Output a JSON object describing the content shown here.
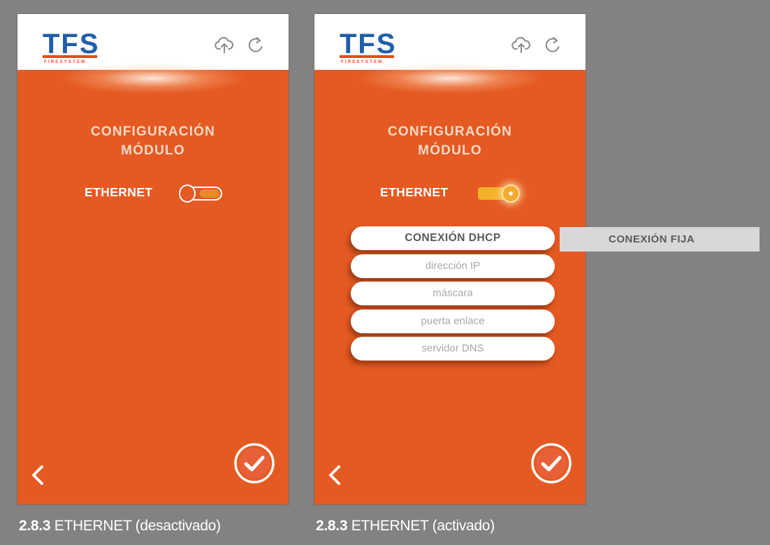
{
  "logo": {
    "text": "TFS",
    "subtext": "FIRESYSTEM"
  },
  "icons": {
    "upload": "cloud-upload-icon",
    "refresh": "refresh-icon",
    "back": "chevron-left-icon",
    "confirm": "check-circle-icon"
  },
  "colors": {
    "background": "#828282",
    "screen": "#e55a22",
    "logo_blue": "#1f5ea8",
    "logo_red": "#e14b1f",
    "toggle_on": "#f4b22a"
  },
  "screens": [
    {
      "title_line1": "CONFIGURACIÓN",
      "title_line2": "MÓDULO",
      "ethernet_label": "ETHERNET",
      "toggle_state": "off"
    },
    {
      "title_line1": "CONFIGURACIÓN",
      "title_line2": "MÓDULO",
      "ethernet_label": "ETHERNET",
      "toggle_state": "on",
      "tab_dhcp": "CONEXIÓN DHCP",
      "tab_fija": "CONEXIÓN FIJA",
      "fields": [
        {
          "placeholder": "dirección IP"
        },
        {
          "placeholder": "máscara"
        },
        {
          "placeholder": "puerta enlace"
        },
        {
          "placeholder": "servidor DNS"
        }
      ]
    }
  ],
  "captions": [
    {
      "number": "2.8.3",
      "text": " ETHERNET (desactivado)"
    },
    {
      "number": "2.8.3",
      "text": " ETHERNET (activado)"
    }
  ]
}
